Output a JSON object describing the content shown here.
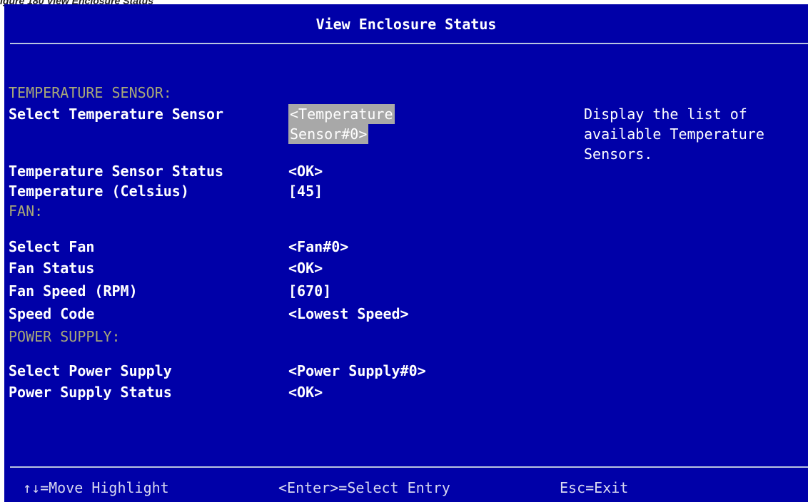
{
  "caption": "igure 180 View Enclosure Status",
  "title": "View Enclosure Status",
  "help_text": "Display the list of\navailable Temperature\nSensors.",
  "sections": {
    "temperature": {
      "header": "TEMPERATURE SENSOR:",
      "select_label": "Select Temperature Sensor",
      "select_value_line1": "<Temperature",
      "select_value_line2": "Sensor#0>",
      "status_label": "Temperature Sensor Status",
      "status_value": "<OK>",
      "temp_label": "Temperature (Celsius)",
      "temp_value": "[45]"
    },
    "fan": {
      "header": "FAN:",
      "select_label": "Select Fan",
      "select_value": "<Fan#0>",
      "status_label": "Fan Status",
      "status_value": "<OK>",
      "speed_label": "Fan Speed (RPM)",
      "speed_value": "[670]",
      "code_label": "Speed Code",
      "code_value": "<Lowest Speed>"
    },
    "power": {
      "header": "POWER SUPPLY:",
      "select_label": "Select Power Supply",
      "select_value": "<Power Supply#0>",
      "status_label": "Power Supply Status",
      "status_value": "<OK>"
    }
  },
  "footer": {
    "move": "↑↓=Move Highlight",
    "enter": "<Enter>=Select Entry",
    "esc": "Esc=Exit"
  },
  "colors": {
    "background": "#0000a8",
    "section_header": "#a8a878",
    "highlight": "#a8a8a8"
  }
}
